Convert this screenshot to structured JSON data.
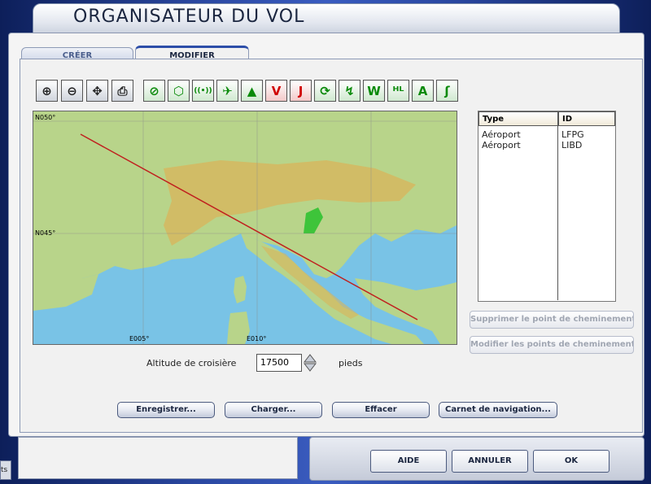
{
  "window": {
    "title": "ORGANISATEUR DU VOL"
  },
  "tabs": [
    {
      "label": "CRÉER"
    },
    {
      "label": "MODIFIER"
    }
  ],
  "toolbar": {
    "buttons": [
      {
        "icon": "zoom-in-icon",
        "glyph": "⊕"
      },
      {
        "icon": "zoom-out-icon",
        "glyph": "⊖"
      },
      {
        "icon": "center-icon",
        "glyph": "✥"
      },
      {
        "icon": "print-icon",
        "glyph": "⎙"
      },
      {
        "icon": "airport-filter-icon",
        "glyph": "⊘"
      },
      {
        "icon": "vor-filter-icon",
        "glyph": "⬡"
      },
      {
        "icon": "ndb-filter-icon",
        "glyph": "((•))"
      },
      {
        "icon": "airway-filter-icon",
        "glyph": "✈"
      },
      {
        "icon": "intersection-filter-icon",
        "glyph": "▲"
      },
      {
        "icon": "victor-airway-icon",
        "glyph": "V"
      },
      {
        "icon": "jet-airway-icon",
        "glyph": "J"
      },
      {
        "icon": "terrain-icon",
        "glyph": "⟳"
      },
      {
        "icon": "route-icon",
        "glyph": "↯"
      },
      {
        "icon": "waypoint-icon",
        "glyph": "W"
      },
      {
        "icon": "hl-airway-icon",
        "glyph": "ᴴᴸ"
      },
      {
        "icon": "altitude-label-icon",
        "glyph": "A"
      },
      {
        "icon": "wind-icon",
        "glyph": "ʃ"
      }
    ]
  },
  "map": {
    "coords": {
      "n050": "N050°",
      "n045": "N045°",
      "e005": "E005°",
      "e010": "E010°"
    },
    "colors": {
      "sea": "#79c3e6",
      "land": "#b8d48a",
      "route": "#c0201f"
    }
  },
  "waypoints": {
    "headers": {
      "type": "Type",
      "id": "ID"
    },
    "rows": [
      {
        "type": "Aéroport",
        "id": "LFPG"
      },
      {
        "type": "Aéroport",
        "id": "LIBD"
      }
    ]
  },
  "side_buttons": {
    "delete": "Supprimer le point de cheminement",
    "modify": "Modifier les points de cheminement"
  },
  "altitude": {
    "label": "Altitude de croisière",
    "value": "17500",
    "unit": "pieds"
  },
  "actions": {
    "save": "Enregistrer...",
    "load": "Charger...",
    "clear": "Effacer",
    "navlog": "Carnet de navigation..."
  },
  "footer": {
    "help": "AIDE",
    "cancel": "ANNULER",
    "ok": "OK",
    "stub": "ts"
  }
}
